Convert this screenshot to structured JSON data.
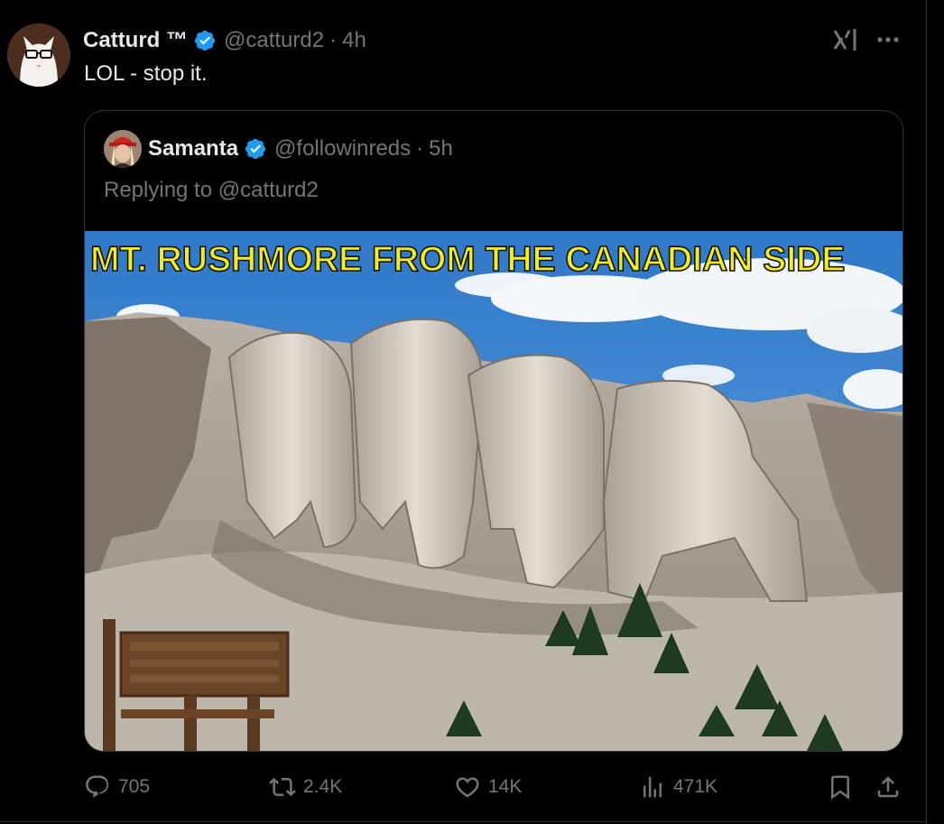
{
  "tweet": {
    "author_name": "Catturd ™",
    "handle": "@catturd2",
    "separator": "·",
    "time": "4h",
    "text": "LOL - stop it."
  },
  "quoted_tweet": {
    "author_name": "Samanta",
    "handle": "@followinreds",
    "separator": "·",
    "time": "5h",
    "replying_prefix": "Replying to",
    "replying_handle": "@catturd2",
    "image_caption": "MT. RUSHMORE FROM THE CANADIAN SIDE"
  },
  "actions": {
    "replies": "705",
    "reposts": "2.4K",
    "likes": "14K",
    "views": "471K"
  },
  "icons": {
    "verified": "verified-badge-icon",
    "grok": "grok-icon",
    "more": "more-icon",
    "reply": "reply-icon",
    "repost": "repost-icon",
    "like": "like-icon",
    "views": "views-icon",
    "bookmark": "bookmark-icon",
    "share": "share-icon"
  },
  "colors": {
    "background": "#000000",
    "text": "#e7e9ea",
    "secondary_text": "#71767b",
    "verified": "#1d9bf0",
    "border": "#2f3336",
    "caption_yellow": "#f4ec1f"
  }
}
